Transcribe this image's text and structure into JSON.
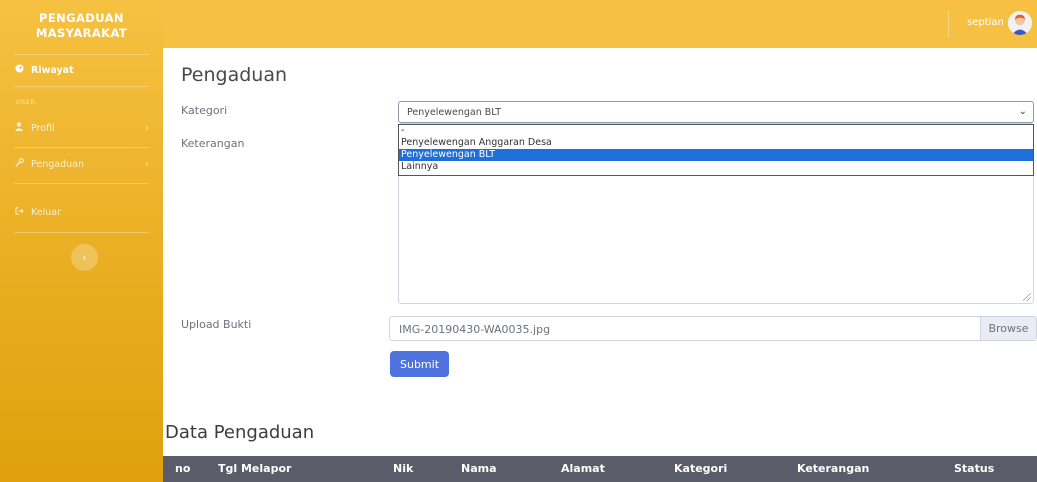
{
  "sidebar": {
    "brand_line1": "PENGADUAN",
    "brand_line2": "MASYARAKAT",
    "active_item": "Riwayat",
    "heading": "USER",
    "items": [
      {
        "label": "Profil",
        "icon": "user-icon"
      },
      {
        "label": "Pengaduan",
        "icon": "wrench-icon"
      },
      {
        "label": "Keluar",
        "icon": "logout-icon"
      }
    ],
    "toggle_icon": "chevron-left-icon"
  },
  "topbar": {
    "username": "septian",
    "avatar_icon": "user-avatar-icon"
  },
  "form": {
    "title": "Pengaduan",
    "kategori_label": "Kategori",
    "kategori_value": "Penyelewengan BLT",
    "keterangan_label": "Keterangan",
    "upload_label": "Upload Bukti",
    "upload_filename": "IMG-20190430-WA0035.jpg",
    "browse_label": "Browse",
    "submit_label": "Submit",
    "options": [
      "-",
      "Penyelewengan Anggaran Desa",
      "Penyelewengan BLT",
      "Lainnya"
    ],
    "selected_option": "Penyelewengan BLT"
  },
  "table": {
    "title": "Data Pengaduan",
    "columns": [
      "no",
      "Tgl Melapor",
      "Nik",
      "Nama",
      "Alamat",
      "Kategori",
      "Keterangan",
      "Status"
    ]
  },
  "colors": {
    "brand_yellow": "#f6c142",
    "primary_blue": "#4e73df",
    "header_gray": "#5a5c69",
    "highlight_blue": "#1e6fd9"
  }
}
